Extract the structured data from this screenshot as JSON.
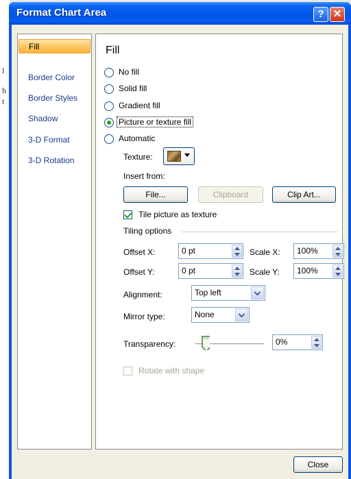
{
  "window": {
    "title": "Format Chart Area",
    "help_glyph": "?",
    "close_glyph": "✕"
  },
  "background": {
    "fragments": [
      "l",
      "h",
      "t"
    ]
  },
  "nav": {
    "items": [
      {
        "label": "Fill",
        "selected": true
      },
      {
        "label": "Border Color",
        "selected": false
      },
      {
        "label": "Border Styles",
        "selected": false
      },
      {
        "label": "Shadow",
        "selected": false
      },
      {
        "label": "3-D Format",
        "selected": false
      },
      {
        "label": "3-D Rotation",
        "selected": false
      }
    ]
  },
  "fill": {
    "heading": "Fill",
    "options": [
      {
        "label": "No fill",
        "checked": false
      },
      {
        "label": "Solid fill",
        "checked": false
      },
      {
        "label": "Gradient fill",
        "checked": false
      },
      {
        "label": "Picture or texture fill",
        "checked": true
      },
      {
        "label": "Automatic",
        "checked": false
      }
    ],
    "texture_label": "Texture:",
    "insert_from_label": "Insert from:",
    "file_button": "File...",
    "clipboard_button": "Clipboard",
    "clipart_button": "Clip Art...",
    "tile_label": "Tile picture as texture",
    "tile_checked": true,
    "tiling_options_label": "Tiling options",
    "offset_x_label": "Offset X:",
    "offset_x_value": "0 pt",
    "scale_x_label": "Scale X:",
    "scale_x_value": "100%",
    "offset_y_label": "Offset Y:",
    "offset_y_value": "0 pt",
    "scale_y_label": "Scale Y:",
    "scale_y_value": "100%",
    "alignment_label": "Alignment:",
    "alignment_value": "Top left",
    "mirror_label": "Mirror type:",
    "mirror_value": "None",
    "transparency_label": "Transparency:",
    "transparency_value": "0%",
    "transparency_level": 0,
    "rotate_label": "Rotate with shape",
    "rotate_checked": false
  },
  "footer": {
    "close_button": "Close"
  }
}
